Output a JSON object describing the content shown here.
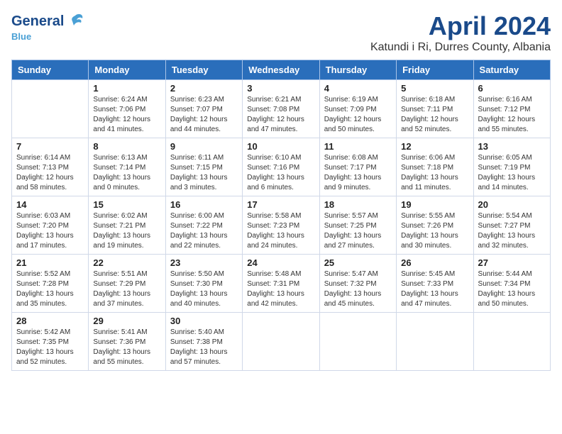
{
  "header": {
    "logo_general": "General",
    "logo_blue": "Blue",
    "title": "April 2024",
    "subtitle": "Katundi i Ri, Durres County, Albania"
  },
  "weekdays": [
    "Sunday",
    "Monday",
    "Tuesday",
    "Wednesday",
    "Thursday",
    "Friday",
    "Saturday"
  ],
  "weeks": [
    [
      {
        "day": "",
        "info": ""
      },
      {
        "day": "1",
        "info": "Sunrise: 6:24 AM\nSunset: 7:06 PM\nDaylight: 12 hours\nand 41 minutes."
      },
      {
        "day": "2",
        "info": "Sunrise: 6:23 AM\nSunset: 7:07 PM\nDaylight: 12 hours\nand 44 minutes."
      },
      {
        "day": "3",
        "info": "Sunrise: 6:21 AM\nSunset: 7:08 PM\nDaylight: 12 hours\nand 47 minutes."
      },
      {
        "day": "4",
        "info": "Sunrise: 6:19 AM\nSunset: 7:09 PM\nDaylight: 12 hours\nand 50 minutes."
      },
      {
        "day": "5",
        "info": "Sunrise: 6:18 AM\nSunset: 7:11 PM\nDaylight: 12 hours\nand 52 minutes."
      },
      {
        "day": "6",
        "info": "Sunrise: 6:16 AM\nSunset: 7:12 PM\nDaylight: 12 hours\nand 55 minutes."
      }
    ],
    [
      {
        "day": "7",
        "info": "Sunrise: 6:14 AM\nSunset: 7:13 PM\nDaylight: 12 hours\nand 58 minutes."
      },
      {
        "day": "8",
        "info": "Sunrise: 6:13 AM\nSunset: 7:14 PM\nDaylight: 13 hours\nand 0 minutes."
      },
      {
        "day": "9",
        "info": "Sunrise: 6:11 AM\nSunset: 7:15 PM\nDaylight: 13 hours\nand 3 minutes."
      },
      {
        "day": "10",
        "info": "Sunrise: 6:10 AM\nSunset: 7:16 PM\nDaylight: 13 hours\nand 6 minutes."
      },
      {
        "day": "11",
        "info": "Sunrise: 6:08 AM\nSunset: 7:17 PM\nDaylight: 13 hours\nand 9 minutes."
      },
      {
        "day": "12",
        "info": "Sunrise: 6:06 AM\nSunset: 7:18 PM\nDaylight: 13 hours\nand 11 minutes."
      },
      {
        "day": "13",
        "info": "Sunrise: 6:05 AM\nSunset: 7:19 PM\nDaylight: 13 hours\nand 14 minutes."
      }
    ],
    [
      {
        "day": "14",
        "info": "Sunrise: 6:03 AM\nSunset: 7:20 PM\nDaylight: 13 hours\nand 17 minutes."
      },
      {
        "day": "15",
        "info": "Sunrise: 6:02 AM\nSunset: 7:21 PM\nDaylight: 13 hours\nand 19 minutes."
      },
      {
        "day": "16",
        "info": "Sunrise: 6:00 AM\nSunset: 7:22 PM\nDaylight: 13 hours\nand 22 minutes."
      },
      {
        "day": "17",
        "info": "Sunrise: 5:58 AM\nSunset: 7:23 PM\nDaylight: 13 hours\nand 24 minutes."
      },
      {
        "day": "18",
        "info": "Sunrise: 5:57 AM\nSunset: 7:25 PM\nDaylight: 13 hours\nand 27 minutes."
      },
      {
        "day": "19",
        "info": "Sunrise: 5:55 AM\nSunset: 7:26 PM\nDaylight: 13 hours\nand 30 minutes."
      },
      {
        "day": "20",
        "info": "Sunrise: 5:54 AM\nSunset: 7:27 PM\nDaylight: 13 hours\nand 32 minutes."
      }
    ],
    [
      {
        "day": "21",
        "info": "Sunrise: 5:52 AM\nSunset: 7:28 PM\nDaylight: 13 hours\nand 35 minutes."
      },
      {
        "day": "22",
        "info": "Sunrise: 5:51 AM\nSunset: 7:29 PM\nDaylight: 13 hours\nand 37 minutes."
      },
      {
        "day": "23",
        "info": "Sunrise: 5:50 AM\nSunset: 7:30 PM\nDaylight: 13 hours\nand 40 minutes."
      },
      {
        "day": "24",
        "info": "Sunrise: 5:48 AM\nSunset: 7:31 PM\nDaylight: 13 hours\nand 42 minutes."
      },
      {
        "day": "25",
        "info": "Sunrise: 5:47 AM\nSunset: 7:32 PM\nDaylight: 13 hours\nand 45 minutes."
      },
      {
        "day": "26",
        "info": "Sunrise: 5:45 AM\nSunset: 7:33 PM\nDaylight: 13 hours\nand 47 minutes."
      },
      {
        "day": "27",
        "info": "Sunrise: 5:44 AM\nSunset: 7:34 PM\nDaylight: 13 hours\nand 50 minutes."
      }
    ],
    [
      {
        "day": "28",
        "info": "Sunrise: 5:42 AM\nSunset: 7:35 PM\nDaylight: 13 hours\nand 52 minutes."
      },
      {
        "day": "29",
        "info": "Sunrise: 5:41 AM\nSunset: 7:36 PM\nDaylight: 13 hours\nand 55 minutes."
      },
      {
        "day": "30",
        "info": "Sunrise: 5:40 AM\nSunset: 7:38 PM\nDaylight: 13 hours\nand 57 minutes."
      },
      {
        "day": "",
        "info": ""
      },
      {
        "day": "",
        "info": ""
      },
      {
        "day": "",
        "info": ""
      },
      {
        "day": "",
        "info": ""
      }
    ]
  ]
}
